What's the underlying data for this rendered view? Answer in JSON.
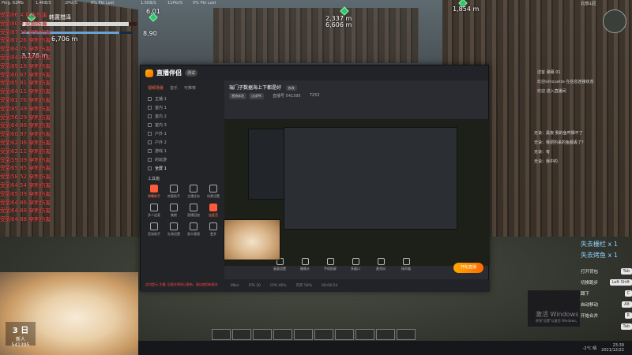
{
  "hud": {
    "ping": "Ping: 62Mb",
    "net": "1.4KB/S",
    "pkt": "2Pkt/S",
    "lost": "0% Pkt Lost",
    "net2": "1.5KB/S",
    "pkt2": "11Pkt/S",
    "lost2": "0% Pkt Lost",
    "region": "北部山区"
  },
  "boss_name": "韩置措泽",
  "floating": [
    {
      "text": "6,706 m"
    },
    {
      "text": "3,176 m"
    },
    {
      "text": "6,01"
    },
    {
      "text": "2,337 m"
    },
    {
      "text": "6,606 m"
    },
    {
      "text": "1,854 m"
    },
    {
      "text": "8,90"
    }
  ],
  "bars": {
    "hp": 0.93,
    "mp": 0.88
  },
  "damage_log": [
    "受到86.4 攻击伤害",
    "受到80.9 火焰伤害",
    "受到87.16 穿刺伤害",
    "受到67.26 穿刺伤害",
    "受到64.75 穿刺伤害",
    "受到84.04 穿刺伤害",
    "受到89.18 穿刺伤害",
    "受到60.67 穿刺伤害",
    "受到65.81 穿刺伤害",
    "受到64.11 穿刺伤害",
    "受到61.76 穿刺伤害",
    "受到85.49 穿刺伤害",
    "受到56.29 穿刺伤害",
    "受到64.88 穿刺伤害",
    "受到60.87 穿刺伤害",
    "受到62.06 穿刺伤害",
    "受到62.11 穿刺伤害",
    "受到59.09 穿刺伤害",
    "受到65.85 穿刺伤害",
    "受到58.52 穿刺伤害",
    "受到64.54 穿刺伤害",
    "受到65.09 穿刺伤害",
    "受到64.86 穿刺伤害",
    "受到64.88 穿刺伤害",
    "受到64.88 穿刺伤害"
  ],
  "app": {
    "title": "直播伴侣",
    "badge": "测试",
    "side_tabs": [
      "视频场景",
      "音乐",
      "可推荐"
    ],
    "scenes": [
      "主播 1",
      "室内 1",
      "室内 2",
      "室内 3",
      "户外 1",
      "户外 2",
      "游戏 1",
      "的玩游",
      "全屏 1"
    ],
    "tools_title": "工具箱",
    "tools": [
      "弹幕助手",
      "房管助手",
      "主播任务",
      "场景设置",
      "多人连麦",
      "美颜",
      "直播回放",
      "连麦音",
      "音效助手",
      "礼物设置",
      "观众管理",
      "更多"
    ],
    "room_title": "瑞门子数据海上下都是好",
    "room_btn": "修改",
    "tags": [
      "营销体验",
      "达成PK"
    ],
    "room_id": "直播号 541395",
    "viewers": "7253",
    "toolbar": [
      "画面设置",
      "摄像头",
      "手机投屏",
      "多窗口",
      "麦克风",
      "扬声器"
    ],
    "start_label": "开始直播",
    "status": [
      "Mb/s",
      "FPS 30",
      "CPU 46%",
      "内存 58%",
      "00:08:54"
    ],
    "warning": "实时提示:主播, 旧版本将停止更新，建议使用新版本"
  },
  "webcam": {
    "badge_big": "3 日",
    "badge_small": "新人",
    "id": "541395"
  },
  "chat": [
    {
      "who": "送客",
      "text": "弹幕 01"
    },
    {
      "who": "欢迎silhouette",
      "text": "在信息连接状态"
    },
    {
      "who": "欢迎",
      "text": "进入直播间"
    }
  ],
  "chat2": [
    {
      "who": "无诀：",
      "text": "黑夜 我的鱼咋搁不了"
    },
    {
      "who": "无诀：",
      "text": "我把钓来的鱼都丢了？"
    },
    {
      "who": "无诀：",
      "text": "有"
    },
    {
      "who": "无诀：",
      "text": "我中的"
    }
  ],
  "lost_items": [
    "失去栅栏 x 1",
    "失去烤鱼 x 1"
  ],
  "hotkeys": [
    {
      "label": "打开背包",
      "key": "Tab"
    },
    {
      "label": "切换跑步",
      "key": "Left Shift"
    },
    {
      "label": "蹲下",
      "key": "C"
    },
    {
      "label": "自动移动",
      "key": "Alt"
    },
    {
      "label": "开始合并",
      "key": "R"
    },
    {
      "label": "",
      "key": "Tab"
    }
  ],
  "watermark": {
    "line1": "激活 Windows",
    "line2": "转到\"设置\"以激活 Windows。"
  },
  "taskbar": {
    "weather": "-2°C 晴",
    "time": "23:39",
    "date": "2021/12/22"
  },
  "top_right": {
    "id": "1,854 m",
    "region": "北部山区"
  }
}
